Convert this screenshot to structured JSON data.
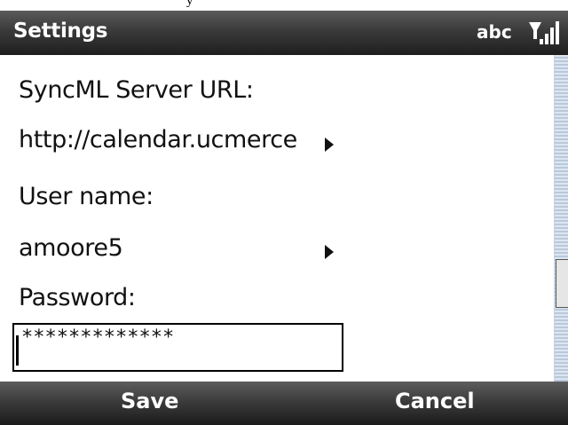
{
  "caption_fragment": "y",
  "titlebar": {
    "title": "Settings",
    "input_mode": "abc",
    "signal_icon": "signal-strength-icon"
  },
  "form": {
    "server_url_label": "SyncML Server URL:",
    "server_url_value": "http://calendar.ucmerce",
    "username_label": "User name:",
    "username_value": "amoore5",
    "password_label": "Password:",
    "password_value": "*************"
  },
  "softkeys": {
    "left": "Save",
    "right": "Cancel"
  },
  "colors": {
    "bar_dark": "#1e1e1e",
    "bar_light": "#5a5a5a",
    "text": "#111111",
    "scroll_track": "#b9c9dc"
  }
}
